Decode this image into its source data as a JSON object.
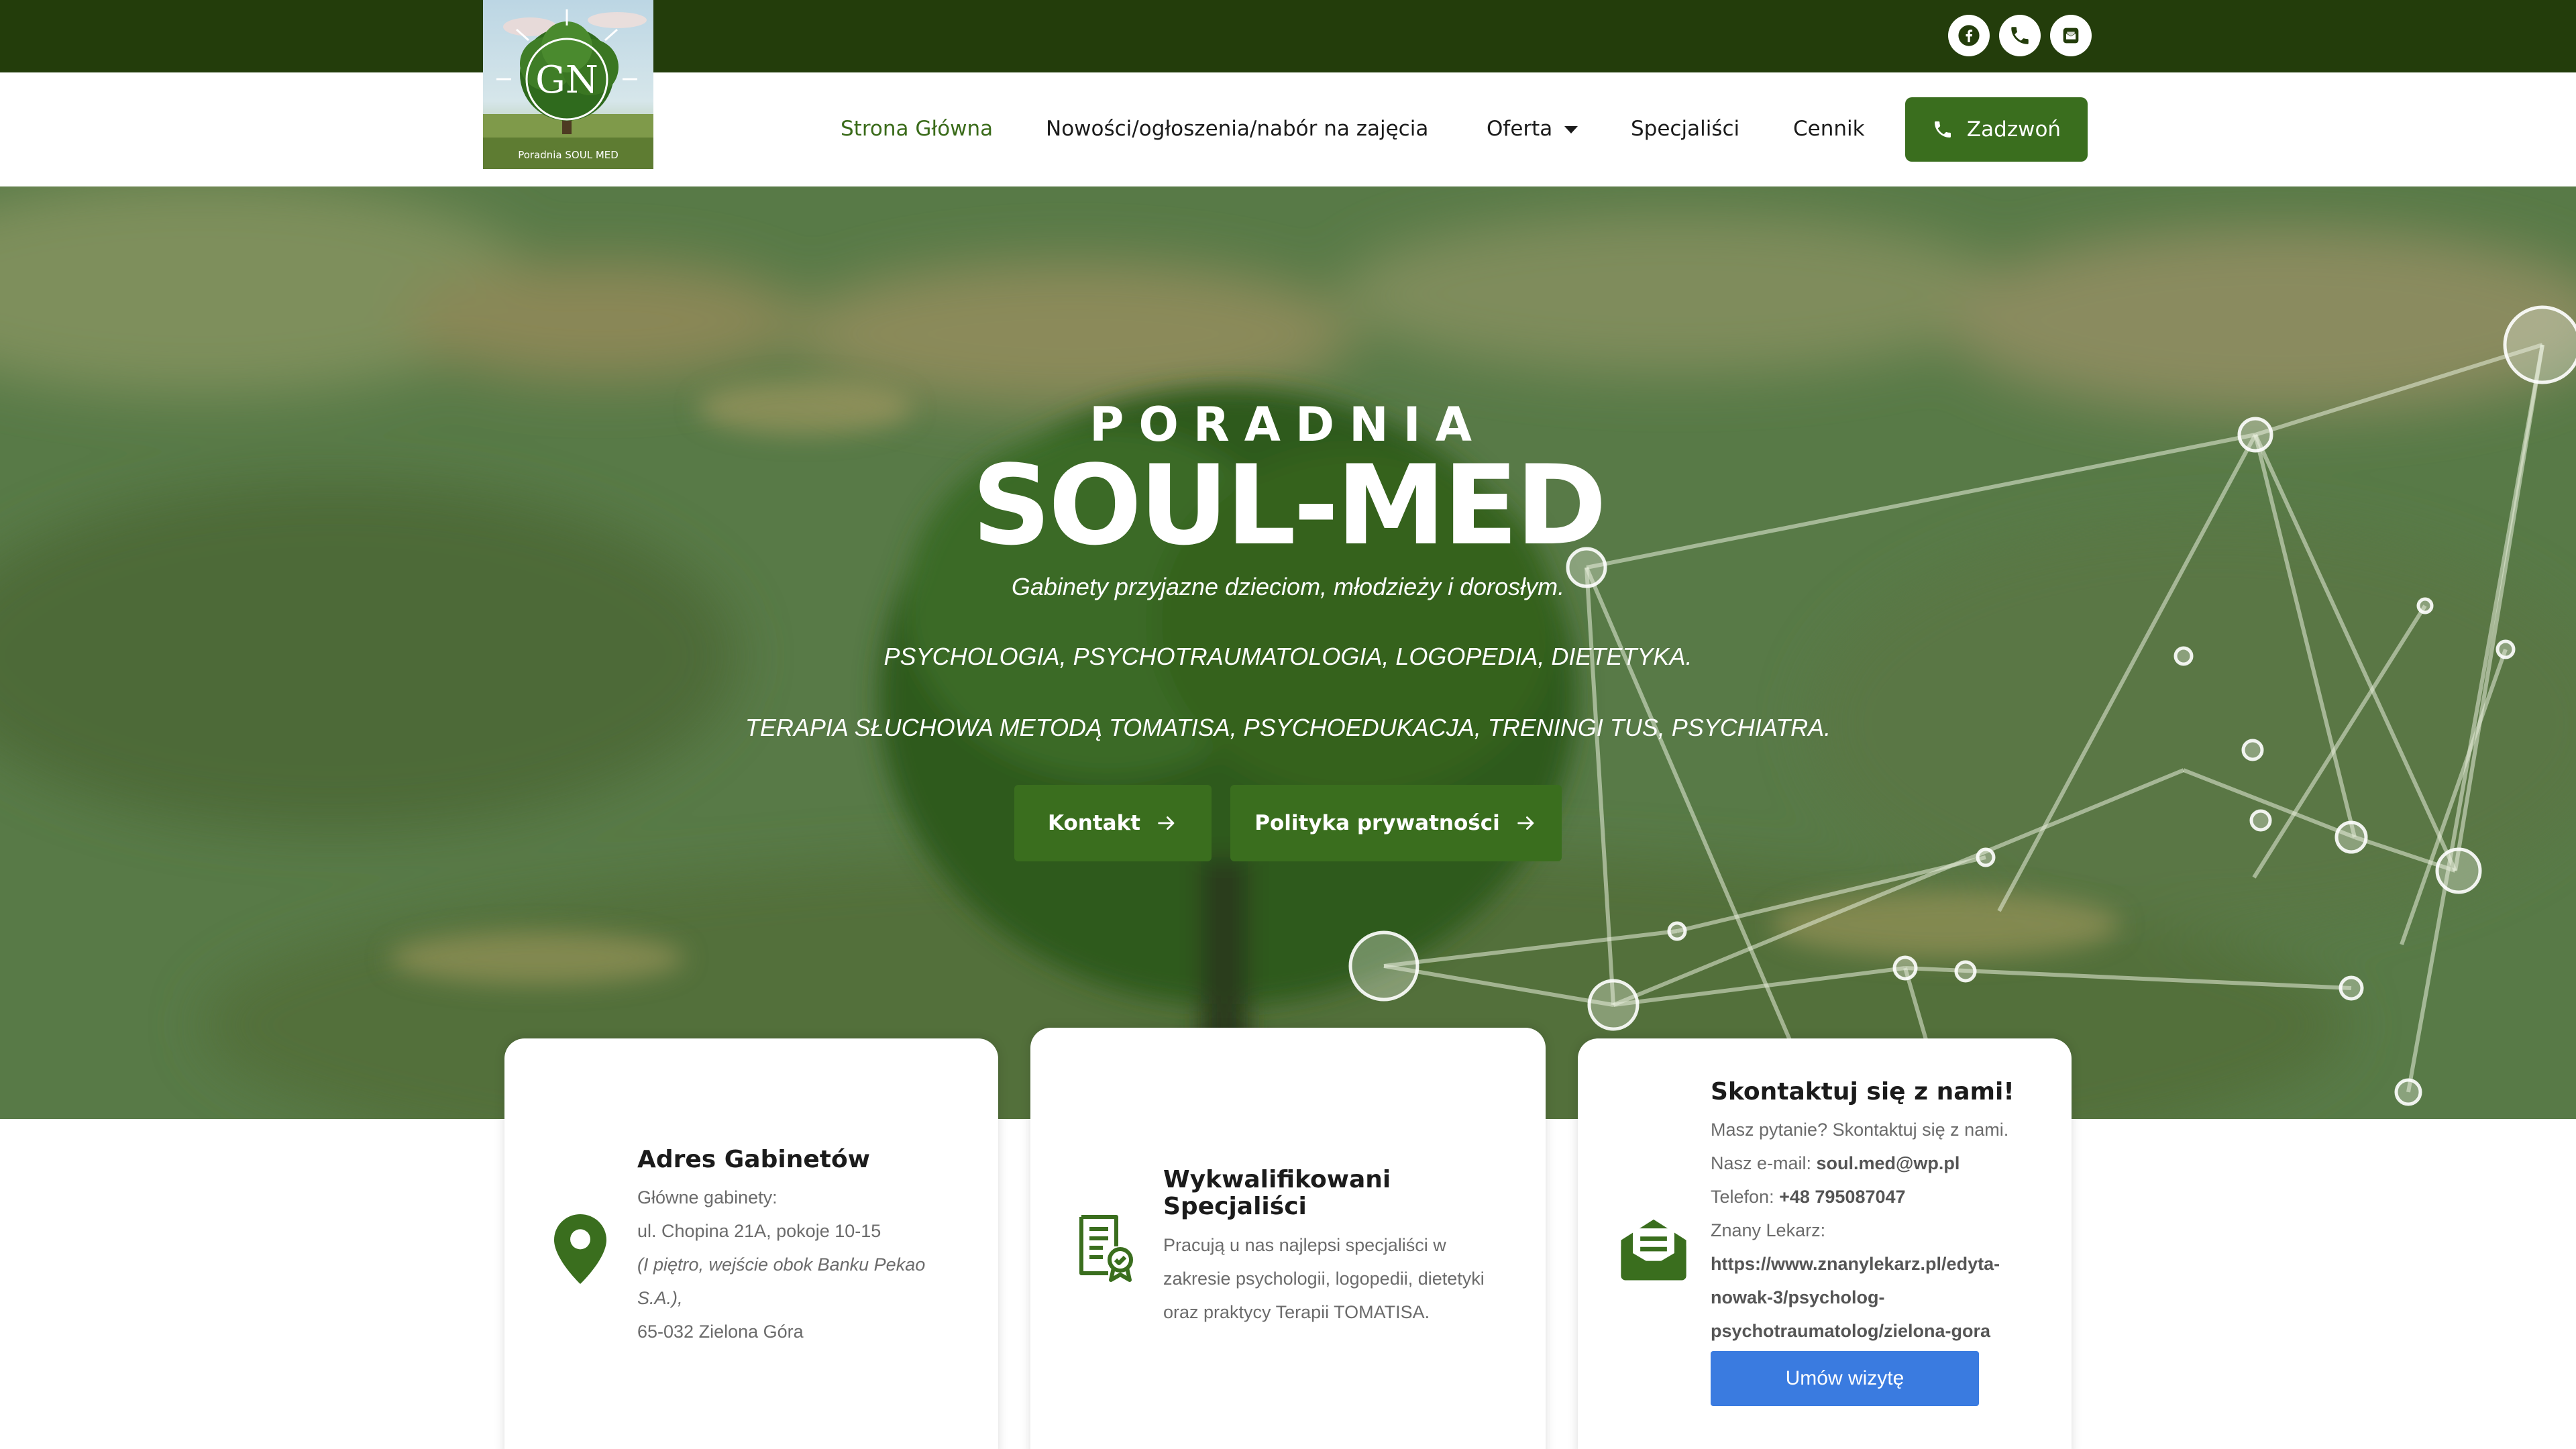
{
  "brand": {
    "logo_caption": "Poradnia SOUL MED",
    "logo_monogram": "GN"
  },
  "topbar": {
    "social": [
      {
        "name": "facebook-icon"
      },
      {
        "name": "phone-icon"
      },
      {
        "name": "envelope-icon"
      }
    ]
  },
  "nav": {
    "items": [
      {
        "label": "Strona Główna",
        "active": true
      },
      {
        "label": "Nowości/ogłoszenia/nabór na zajęcia"
      },
      {
        "label": "Oferta",
        "has_dropdown": true
      },
      {
        "label": "Specjaliści"
      },
      {
        "label": "Cennik"
      }
    ],
    "call_button": "Zadzwoń"
  },
  "hero": {
    "pre_title": "PORADNIA",
    "title": "SOUL-MED",
    "line1": "Gabinety przyjazne dzieciom, młodzieży i dorosłym.",
    "line2": "PSYCHOLOGIA, PSYCHOTRAUMATOLOGIA,  LOGOPEDIA, DIETETYKA.",
    "line3": "TERAPIA SŁUCHOWA METODĄ TOMATISA, PSYCHOEDUKACJA, TRENINGI TUS, PSYCHIATRA.",
    "buttons": [
      "Kontakt",
      "Polityka prywatności"
    ]
  },
  "cards": {
    "address": {
      "title": "Adres Gabinetów",
      "line1": "Główne gabinety:",
      "line2": "ul. Chopina 21A, pokoje 10-15",
      "line3a": "(I piętro, wejście obok Banku Pekao",
      "line3b": "S.A.),",
      "line4": "65-032 Zielona Góra"
    },
    "specialists": {
      "title1": "Wykwalifikowani",
      "title2": "Specjaliści",
      "line1": "Pracują u nas najlepsi specjaliści w",
      "line2": "zakresie psychologii, logopedii, dietetyki",
      "line3": "oraz praktycy Terapii TOMATISA."
    },
    "contact": {
      "title": "Skontaktuj się z nami!",
      "line1": "Masz pytanie? Skontaktuj się z nami.",
      "email_label": "Nasz e-mail: ",
      "email": "soul.med@wp.pl",
      "phone_label": "Telefon: ",
      "phone": "+48 795087047",
      "zl_label": "Znany Lekarz:",
      "url1": "https://www.znanylekarz.pl/edyta-",
      "url2": "nowak-3/psycholog-",
      "url3": "psychotraumatolog/zielona-gora",
      "book_button": "Umów wizytę"
    }
  },
  "colors": {
    "topbar": "#233d0b",
    "accent": "#3a6e1e",
    "book_button": "#3a7be0"
  }
}
